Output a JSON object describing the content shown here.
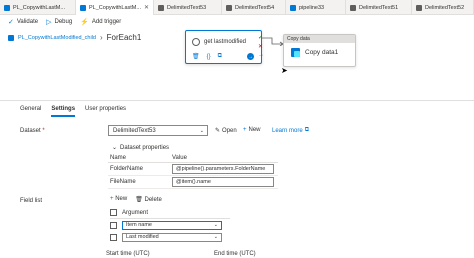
{
  "tabs": [
    {
      "label": "PL_CopywithLastM...",
      "active": false
    },
    {
      "label": "PL_CopywithLastM...",
      "active": true
    },
    {
      "label": "DelimitedText53",
      "active": false
    },
    {
      "label": "DelimitedText54",
      "active": false
    },
    {
      "label": "pipeline33",
      "active": false
    },
    {
      "label": "DelimitedText51",
      "active": false
    },
    {
      "label": "DelimitedText52",
      "active": false
    }
  ],
  "toolbar": {
    "validate": "Validate",
    "debug": "Debug",
    "add_trigger": "Add trigger"
  },
  "breadcrumb": {
    "parent": "PL_CopywithLastModified_child",
    "current": "ForEach1"
  },
  "canvas": {
    "get_metadata_label": "get lastmodified",
    "copy_header": "Copy data",
    "copy_label": "Copy data1",
    "side_check": "✓",
    "side_x": "✕",
    "side_arrow": "→"
  },
  "panel": {
    "tabs": [
      "General",
      "Settings",
      "User properties"
    ],
    "active_tab": "Settings",
    "dataset_label": "Dataset",
    "required_marker": "*",
    "dataset_value": "DelimitedText53",
    "open_label": "Open",
    "new_label": "New",
    "learn_more": "Learn more",
    "dataset_properties": "Dataset properties",
    "table_headers": {
      "name": "Name",
      "value": "Value"
    },
    "properties": [
      {
        "name": "FolderName",
        "value": "@pipeline().parameters.FolderName"
      },
      {
        "name": "FileName",
        "value": "@item().name"
      }
    ],
    "field_list_label": "Field list",
    "field_new": "New",
    "field_delete": "Delete",
    "field_header": "Argument",
    "fields": [
      {
        "value": "Item name",
        "focused": true
      },
      {
        "value": "Last modified",
        "focused": false
      }
    ],
    "start_time": "Start time (UTC)",
    "end_time": "End time (UTC)"
  }
}
